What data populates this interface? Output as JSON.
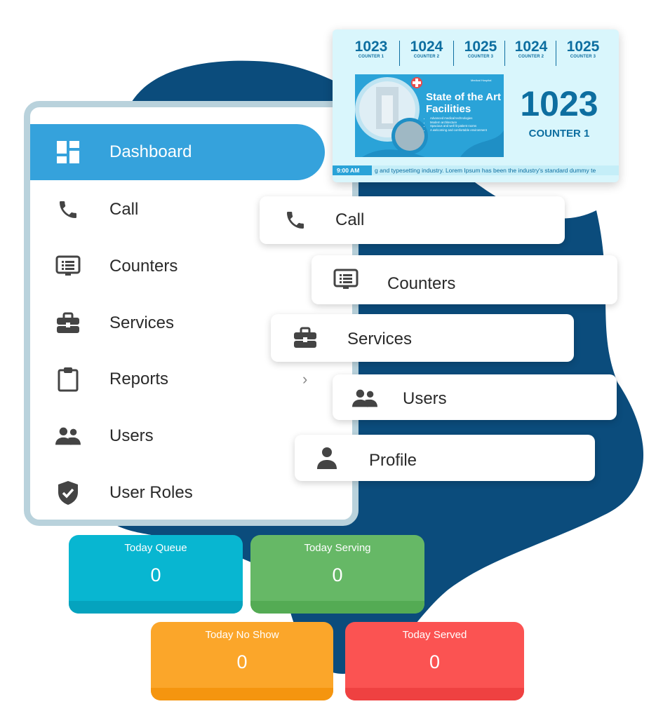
{
  "sidebar": {
    "items": [
      {
        "label": "Dashboard",
        "icon": "dashboard-icon"
      },
      {
        "label": "Call",
        "icon": "phone-icon"
      },
      {
        "label": "Counters",
        "icon": "monitor-list-icon"
      },
      {
        "label": "Services",
        "icon": "briefcase-icon"
      },
      {
        "label": "Reports",
        "icon": "clipboard-icon"
      },
      {
        "label": "Users",
        "icon": "users-icon"
      },
      {
        "label": "User Roles",
        "icon": "shield-check-icon"
      }
    ],
    "reports_chevron": "›"
  },
  "floating_menu": {
    "call": "Call",
    "counters": "Counters",
    "services": "Services",
    "users": "Users",
    "profile": "Profile"
  },
  "display": {
    "queue": [
      {
        "number": "1023",
        "counter": "COUNTER 1"
      },
      {
        "number": "1024",
        "counter": "COUNTER 2"
      },
      {
        "number": "1025",
        "counter": "COUNTER 3"
      },
      {
        "number": "1024",
        "counter": "COUNTER 2"
      },
      {
        "number": "1025",
        "counter": "COUNTER 3"
      }
    ],
    "promo": {
      "brand": "Medical Hospital",
      "title": "State of the Art Facilities",
      "bullets": [
        "Advanced medical technologies",
        "Modern architecture",
        "Spacious and well lit patient rooms",
        "A welcoming and comfortable environment"
      ]
    },
    "current_number": "1023",
    "current_counter": "COUNTER 1",
    "ticker_time": "9:00 AM",
    "ticker_text": "g and typesetting industry. Lorem Ipsum has been the industry's standard dummy te"
  },
  "stats": {
    "today_queue": {
      "label": "Today Queue",
      "value": "0"
    },
    "today_serving": {
      "label": "Today Serving",
      "value": "0"
    },
    "today_no_show": {
      "label": "Today No Show",
      "value": "0"
    },
    "today_served": {
      "label": "Today Served",
      "value": "0"
    }
  },
  "colors": {
    "accent": "#35a2dc",
    "blob": "#0b4c7c",
    "queue_tile": "#08b6d1",
    "serving_tile": "#66b866",
    "no_show_tile": "#fba62a",
    "served_tile": "#fb5352"
  }
}
